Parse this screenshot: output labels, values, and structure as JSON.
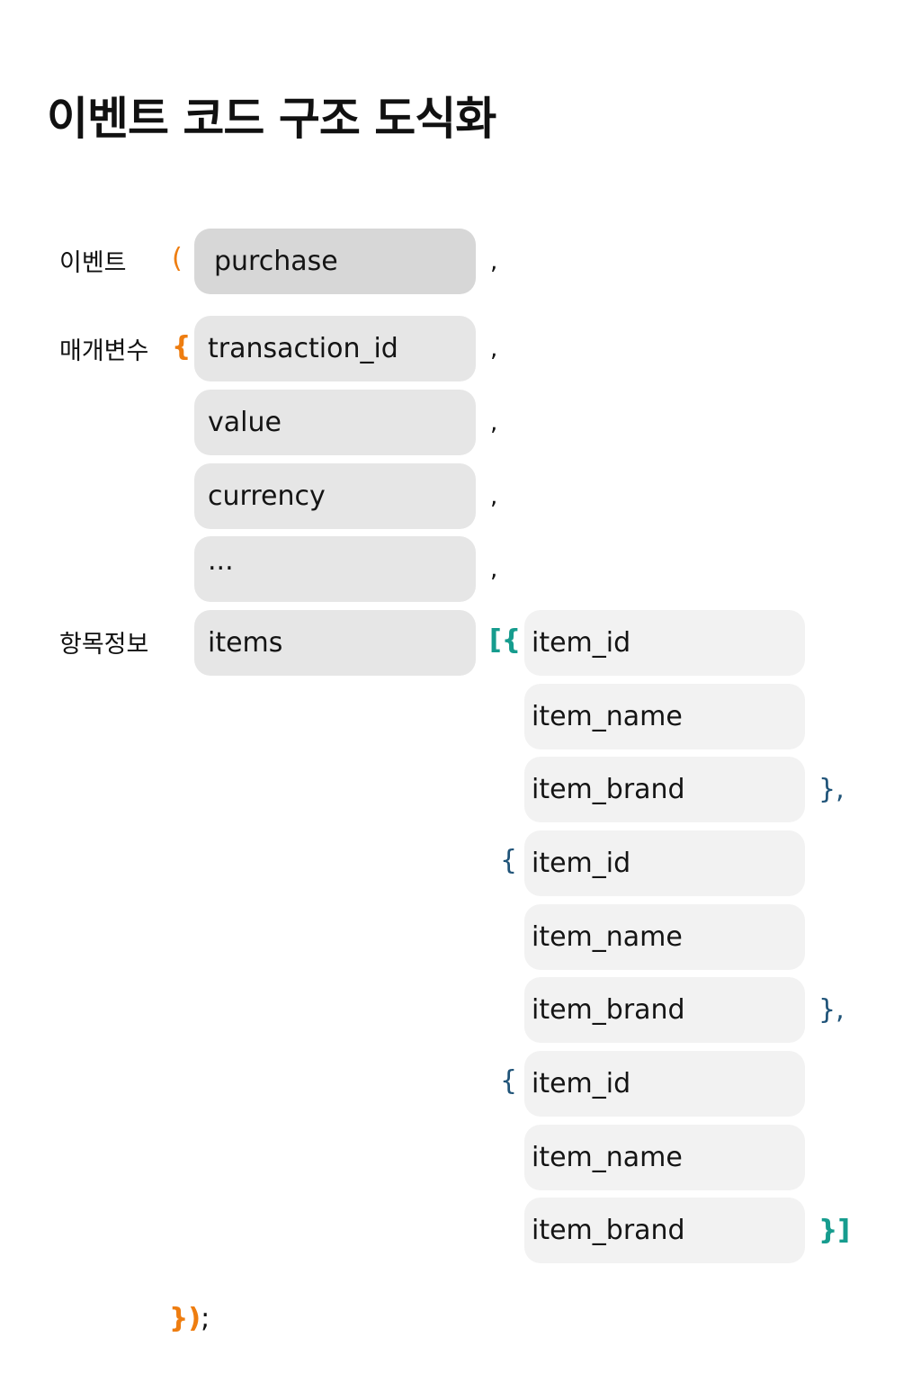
{
  "title": "이벤트 코드 구조 도식화",
  "labels": {
    "event": "이벤트",
    "params": "매개변수",
    "items": "항목정보"
  },
  "event_name": "purchase",
  "params": [
    "transaction_id",
    "value",
    "currency",
    "..."
  ],
  "items_key": "items",
  "item_fields": [
    "item_id",
    "item_name",
    "item_brand",
    "item_id",
    "item_name",
    "item_brand",
    "item_id",
    "item_name",
    "item_brand"
  ],
  "punct": {
    "open_paren": "(",
    "open_brace": "{",
    "comma": ",",
    "open_array": "[{",
    "obj_open": "{",
    "obj_close": "},",
    "array_close": "}]",
    "end_brackets": "})",
    "semicolon": ";"
  },
  "colors": {
    "orange": "#ee7d10",
    "teal": "#169c8e",
    "navy": "#1f5378",
    "event_box": "#d7d7d7",
    "param_box": "#e6e6e6",
    "item_box": "#f2f2f2"
  }
}
